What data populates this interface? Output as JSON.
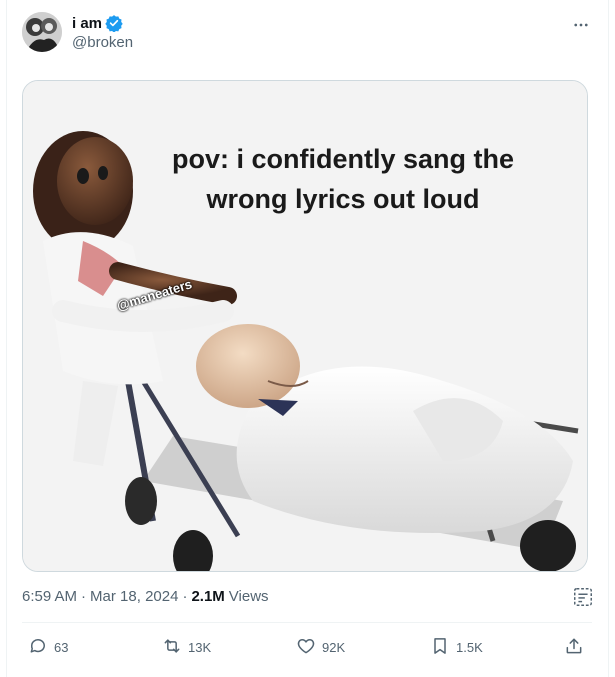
{
  "tweet": {
    "author": {
      "display_name": "i am",
      "handle": "@broken",
      "verified": true,
      "verified_color": "#1d9bf0"
    },
    "more_icon": "more-horizontal-icon",
    "media": {
      "caption": "pov: i confidently sang the wrong lyrics out loud",
      "watermark": "@maneaters"
    },
    "meta": {
      "time": "6:59 AM",
      "separator1": "·",
      "date": "Mar 18, 2024",
      "separator2": "·",
      "views_count": "2.1M",
      "views_label": "Views"
    },
    "actions": {
      "reply_count": "63",
      "retweet_count": "13K",
      "like_count": "92K",
      "bookmark_count": "1.5K"
    }
  }
}
